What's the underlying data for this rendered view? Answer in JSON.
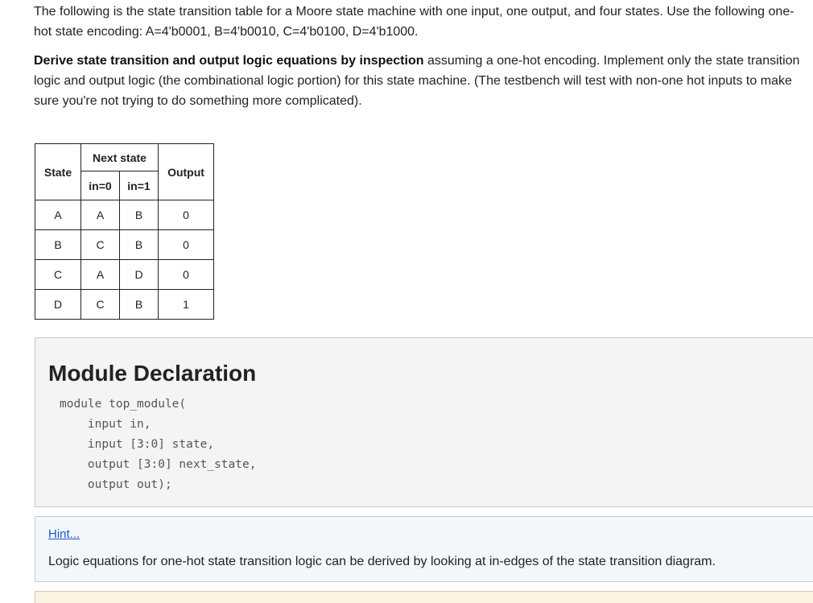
{
  "intro": {
    "text": "The following is the state transition table for a Moore state machine with one input, one output, and four states. Use the following one-hot state encoding: A=4'b0001, B=4'b0010, C=4'b0100, D=4'b1000."
  },
  "task": {
    "bold": "Derive state transition and output logic equations by inspection",
    "text": " assuming a one-hot encoding. Implement only the state transition logic and output logic (the combinational logic portion) for this state machine. (The testbench will test with non-one hot inputs to make sure you're not trying to do something more complicated)."
  },
  "table": {
    "headers": {
      "state": "State",
      "next_state": "Next state",
      "in0": "in=0",
      "in1": "in=1",
      "output": "Output"
    },
    "rows": [
      {
        "state": "A",
        "in0": "A",
        "in1": "B",
        "out": "0"
      },
      {
        "state": "B",
        "in0": "C",
        "in1": "B",
        "out": "0"
      },
      {
        "state": "C",
        "in0": "A",
        "in1": "D",
        "out": "0"
      },
      {
        "state": "D",
        "in0": "C",
        "in1": "B",
        "out": "1"
      }
    ]
  },
  "module": {
    "heading": "Module Declaration",
    "code": "module top_module(\n    input in,\n    input [3:0] state,\n    output [3:0] next_state,\n    output out);"
  },
  "hint": {
    "link": "Hint...",
    "text": "Logic equations for one-hot state transition logic can be derived by looking at in-edges of the state transition diagram."
  }
}
